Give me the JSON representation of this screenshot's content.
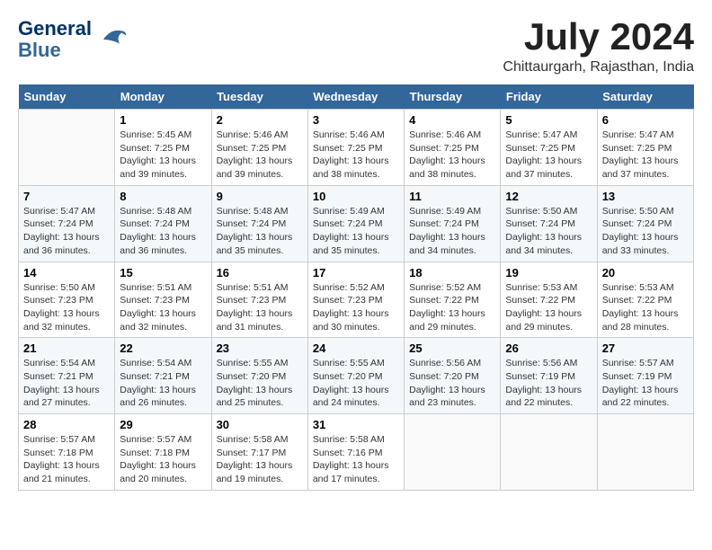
{
  "header": {
    "logo_line1": "General",
    "logo_line2": "Blue",
    "month_title": "July 2024",
    "location": "Chittaurgarh, Rajasthan, India"
  },
  "days_of_week": [
    "Sunday",
    "Monday",
    "Tuesday",
    "Wednesday",
    "Thursday",
    "Friday",
    "Saturday"
  ],
  "weeks": [
    [
      {
        "day": "",
        "sunrise": "",
        "sunset": "",
        "daylight": ""
      },
      {
        "day": "1",
        "sunrise": "5:45 AM",
        "sunset": "7:25 PM",
        "daylight": "13 hours and 39 minutes."
      },
      {
        "day": "2",
        "sunrise": "5:46 AM",
        "sunset": "7:25 PM",
        "daylight": "13 hours and 39 minutes."
      },
      {
        "day": "3",
        "sunrise": "5:46 AM",
        "sunset": "7:25 PM",
        "daylight": "13 hours and 38 minutes."
      },
      {
        "day": "4",
        "sunrise": "5:46 AM",
        "sunset": "7:25 PM",
        "daylight": "13 hours and 38 minutes."
      },
      {
        "day": "5",
        "sunrise": "5:47 AM",
        "sunset": "7:25 PM",
        "daylight": "13 hours and 37 minutes."
      },
      {
        "day": "6",
        "sunrise": "5:47 AM",
        "sunset": "7:25 PM",
        "daylight": "13 hours and 37 minutes."
      }
    ],
    [
      {
        "day": "7",
        "sunrise": "5:47 AM",
        "sunset": "7:24 PM",
        "daylight": "13 hours and 36 minutes."
      },
      {
        "day": "8",
        "sunrise": "5:48 AM",
        "sunset": "7:24 PM",
        "daylight": "13 hours and 36 minutes."
      },
      {
        "day": "9",
        "sunrise": "5:48 AM",
        "sunset": "7:24 PM",
        "daylight": "13 hours and 35 minutes."
      },
      {
        "day": "10",
        "sunrise": "5:49 AM",
        "sunset": "7:24 PM",
        "daylight": "13 hours and 35 minutes."
      },
      {
        "day": "11",
        "sunrise": "5:49 AM",
        "sunset": "7:24 PM",
        "daylight": "13 hours and 34 minutes."
      },
      {
        "day": "12",
        "sunrise": "5:50 AM",
        "sunset": "7:24 PM",
        "daylight": "13 hours and 34 minutes."
      },
      {
        "day": "13",
        "sunrise": "5:50 AM",
        "sunset": "7:24 PM",
        "daylight": "13 hours and 33 minutes."
      }
    ],
    [
      {
        "day": "14",
        "sunrise": "5:50 AM",
        "sunset": "7:23 PM",
        "daylight": "13 hours and 32 minutes."
      },
      {
        "day": "15",
        "sunrise": "5:51 AM",
        "sunset": "7:23 PM",
        "daylight": "13 hours and 32 minutes."
      },
      {
        "day": "16",
        "sunrise": "5:51 AM",
        "sunset": "7:23 PM",
        "daylight": "13 hours and 31 minutes."
      },
      {
        "day": "17",
        "sunrise": "5:52 AM",
        "sunset": "7:23 PM",
        "daylight": "13 hours and 30 minutes."
      },
      {
        "day": "18",
        "sunrise": "5:52 AM",
        "sunset": "7:22 PM",
        "daylight": "13 hours and 29 minutes."
      },
      {
        "day": "19",
        "sunrise": "5:53 AM",
        "sunset": "7:22 PM",
        "daylight": "13 hours and 29 minutes."
      },
      {
        "day": "20",
        "sunrise": "5:53 AM",
        "sunset": "7:22 PM",
        "daylight": "13 hours and 28 minutes."
      }
    ],
    [
      {
        "day": "21",
        "sunrise": "5:54 AM",
        "sunset": "7:21 PM",
        "daylight": "13 hours and 27 minutes."
      },
      {
        "day": "22",
        "sunrise": "5:54 AM",
        "sunset": "7:21 PM",
        "daylight": "13 hours and 26 minutes."
      },
      {
        "day": "23",
        "sunrise": "5:55 AM",
        "sunset": "7:20 PM",
        "daylight": "13 hours and 25 minutes."
      },
      {
        "day": "24",
        "sunrise": "5:55 AM",
        "sunset": "7:20 PM",
        "daylight": "13 hours and 24 minutes."
      },
      {
        "day": "25",
        "sunrise": "5:56 AM",
        "sunset": "7:20 PM",
        "daylight": "13 hours and 23 minutes."
      },
      {
        "day": "26",
        "sunrise": "5:56 AM",
        "sunset": "7:19 PM",
        "daylight": "13 hours and 22 minutes."
      },
      {
        "day": "27",
        "sunrise": "5:57 AM",
        "sunset": "7:19 PM",
        "daylight": "13 hours and 22 minutes."
      }
    ],
    [
      {
        "day": "28",
        "sunrise": "5:57 AM",
        "sunset": "7:18 PM",
        "daylight": "13 hours and 21 minutes."
      },
      {
        "day": "29",
        "sunrise": "5:57 AM",
        "sunset": "7:18 PM",
        "daylight": "13 hours and 20 minutes."
      },
      {
        "day": "30",
        "sunrise": "5:58 AM",
        "sunset": "7:17 PM",
        "daylight": "13 hours and 19 minutes."
      },
      {
        "day": "31",
        "sunrise": "5:58 AM",
        "sunset": "7:16 PM",
        "daylight": "13 hours and 17 minutes."
      },
      {
        "day": "",
        "sunrise": "",
        "sunset": "",
        "daylight": ""
      },
      {
        "day": "",
        "sunrise": "",
        "sunset": "",
        "daylight": ""
      },
      {
        "day": "",
        "sunrise": "",
        "sunset": "",
        "daylight": ""
      }
    ]
  ]
}
